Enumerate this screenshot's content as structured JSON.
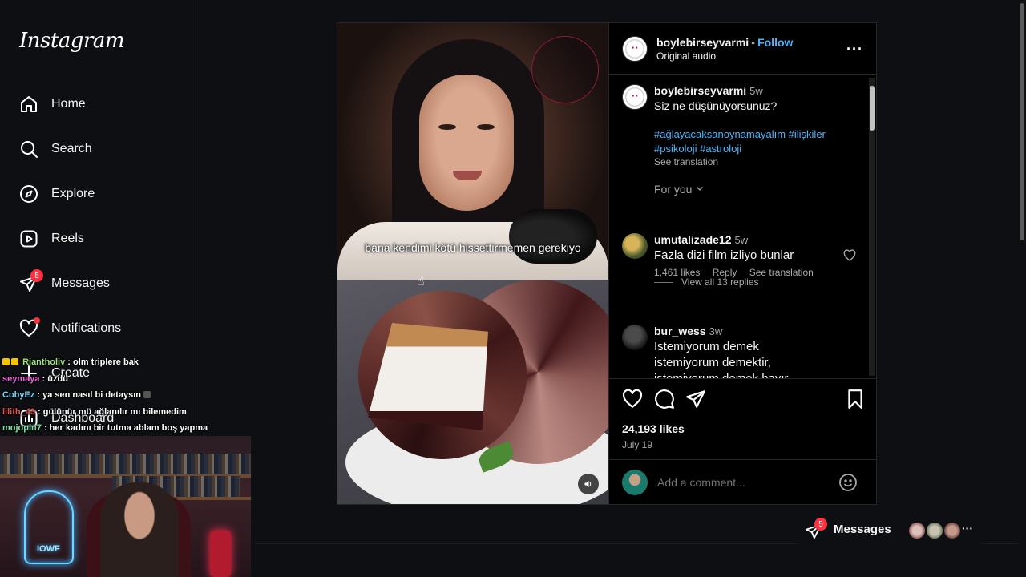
{
  "brand": {
    "logo_text": "Instagram"
  },
  "sidebar": {
    "items": [
      {
        "label": "Home",
        "icon": "home-icon"
      },
      {
        "label": "Search",
        "icon": "search-icon"
      },
      {
        "label": "Explore",
        "icon": "compass-icon"
      },
      {
        "label": "Reels",
        "icon": "reels-icon"
      },
      {
        "label": "Messages",
        "icon": "messenger-icon",
        "badge": "5"
      },
      {
        "label": "Notifications",
        "icon": "heart-icon"
      },
      {
        "label": "Create",
        "icon": "plus-icon"
      },
      {
        "label": "Dashboard",
        "icon": "dashboard-icon"
      }
    ]
  },
  "stream_chat": [
    {
      "user": "Riantholiv",
      "text": " : olm triplere bak"
    },
    {
      "user": "seymaya",
      "text": " : üzdü"
    },
    {
      "user": "CobyEz",
      "text": " : ya sen nasıl bi detaysın"
    },
    {
      "user": "lilith_43",
      "text": " : gülünür mü ağlanılır mı bilemedim"
    },
    {
      "user": "mojopin7",
      "text": " : her kadını bir tutma ablam boş yapma"
    }
  ],
  "webcam": {
    "neon_text": "IOWF"
  },
  "post": {
    "video_caption": "bana kendimi kötü hissettirmemen gerekiyo",
    "header": {
      "username": "boylebirseyvarmi",
      "separator": "•",
      "follow_label": "Follow",
      "audio": "Original audio"
    },
    "caption": {
      "username": "boylebirseyvarmi",
      "time": "5w",
      "text": "Siz ne düşünüyorsunuz?",
      "tags_line1": "#ağlayacaksanoynamayalım #ilişkiler",
      "tags_line2": "#psikoloji #astroloji",
      "see_translation": "See translation"
    },
    "sort_label": "For you",
    "comments": [
      {
        "username": "umutalizade12",
        "time": "5w",
        "text": "Fazla dizi film izliyo bunlar",
        "likes": "1,461 likes",
        "reply": "Reply",
        "see_translation": "See translation"
      },
      {
        "username": "bur_wess",
        "time": "3w",
        "text": "Istemiyorum demek istemiyorum demektir, istemiyorum demek hayır demektir BUNU"
      }
    ],
    "view_replies": "View all 13 replies",
    "likes": "24,193 likes",
    "date": "July 19",
    "add_comment_placeholder": "Add a comment..."
  },
  "messages_pill": {
    "label": "Messages",
    "badge": "5"
  },
  "colors": {
    "accent": "#4cb5f9",
    "badge": "#ff3040",
    "background": "#0d0f12"
  }
}
